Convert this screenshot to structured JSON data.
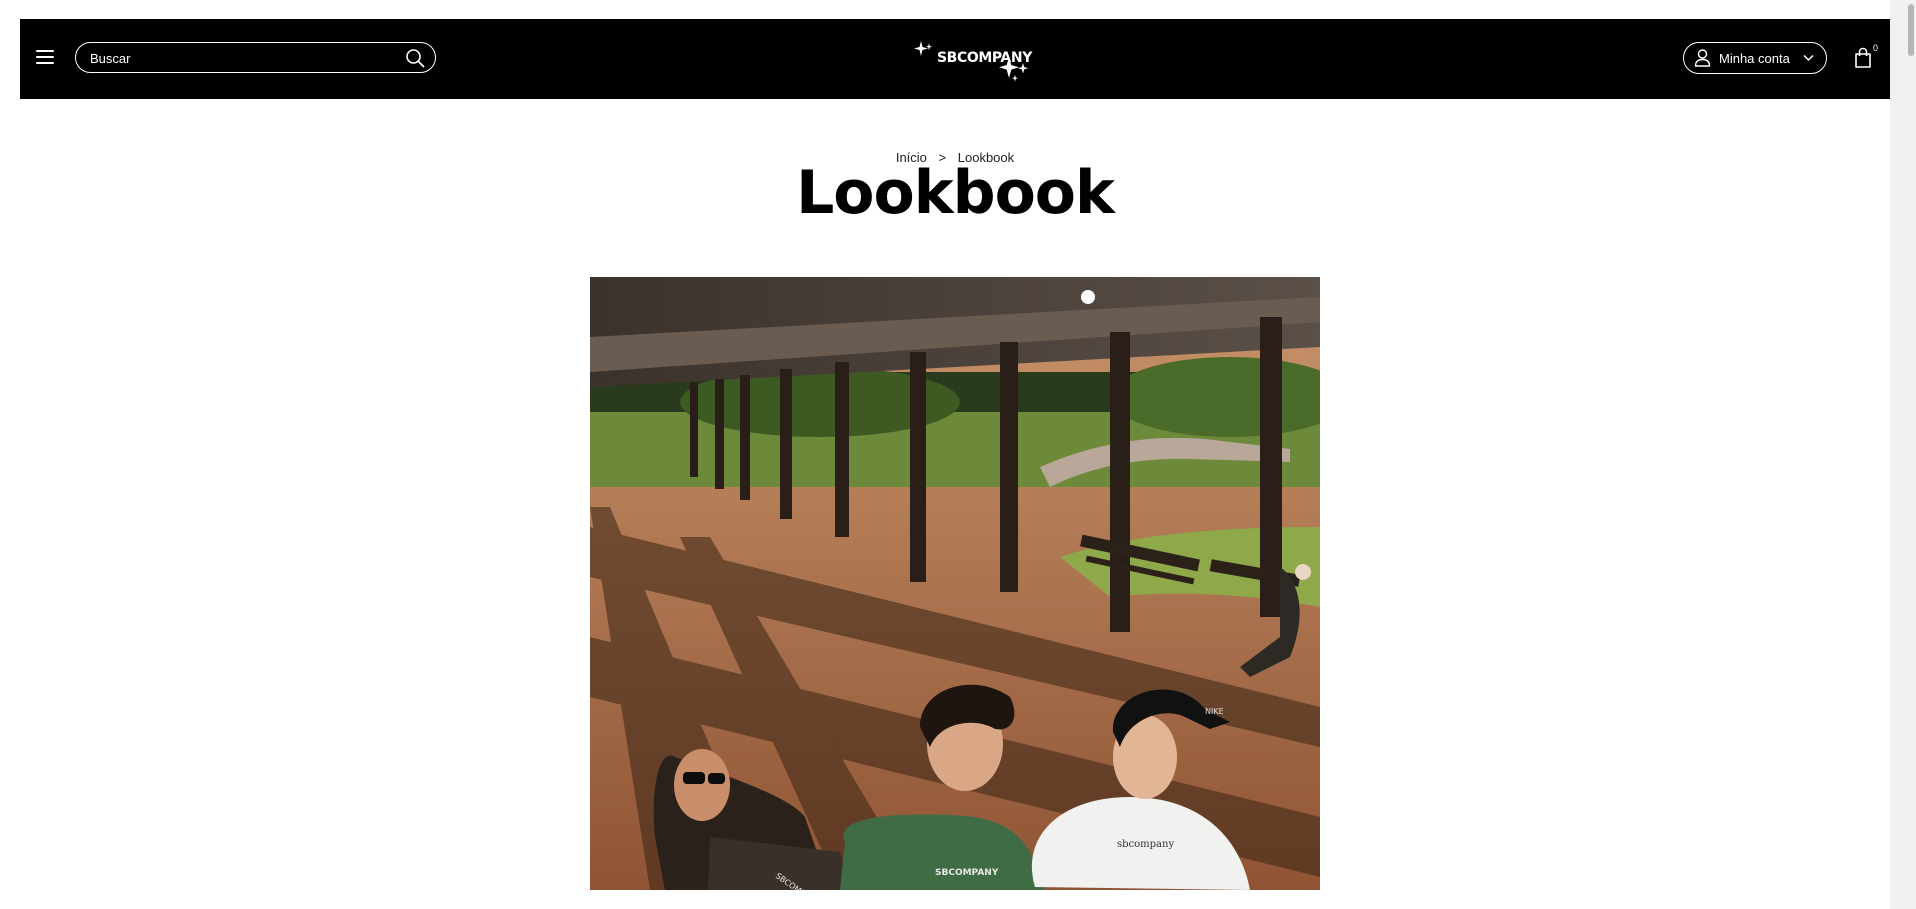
{
  "header": {
    "search": {
      "placeholder": "Buscar",
      "value": ""
    },
    "logo_text": "SBCOMPANY",
    "account_label": "Minha conta",
    "cart_count": "0"
  },
  "breadcrumb": {
    "home": "Início",
    "separator": ">",
    "current": "Lookbook"
  },
  "page": {
    "title": "Lookbook"
  },
  "photo": {
    "shirt_print_left": "SBCOMPANY",
    "shirt_print_middle": "SBCOMPANY",
    "shirt_print_right": "sbcompany",
    "cap_logo": "NIKE"
  },
  "colors": {
    "header_bg": "#000000",
    "header_text": "#ffffff",
    "page_bg": "#ffffff"
  },
  "icons": [
    "menu-icon",
    "search-icon",
    "user-icon",
    "chevron-down-icon",
    "shopping-bag-icon",
    "sparkle-logo-icon"
  ]
}
